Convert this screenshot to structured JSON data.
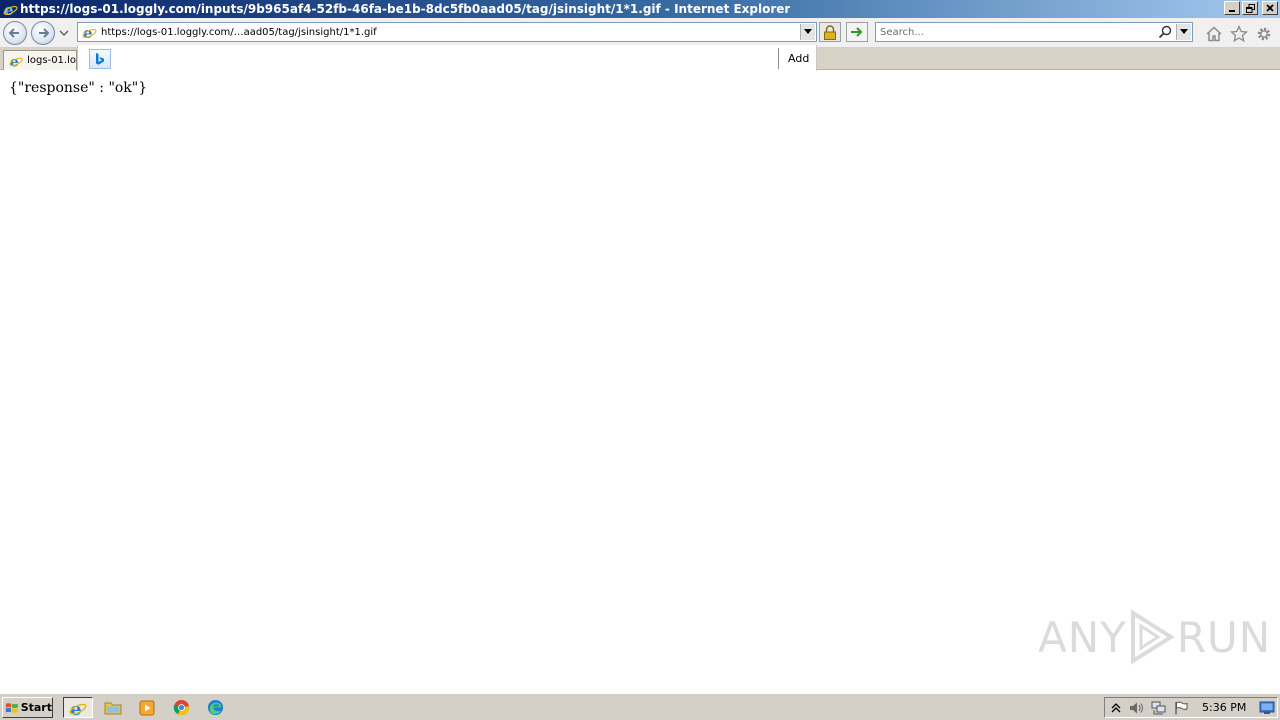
{
  "window": {
    "title": "https://logs-01.loggly.com/inputs/9b965af4-52fb-46fa-be1b-8dc5fb0aad05/tag/jsinsight/1*1.gif - Internet Explorer"
  },
  "address_bar": {
    "url_display": "https://logs-01.loggly.com/…aad05/tag/jsinsight/1*1.gif"
  },
  "search": {
    "placeholder": "Search..."
  },
  "tab": {
    "label": "logs-01.lo"
  },
  "suggestions": {
    "add_label": "Add"
  },
  "page": {
    "body_text": "{\"response\" : \"ok\"}"
  },
  "watermark": {
    "left": "ANY",
    "right": "RUN"
  },
  "taskbar": {
    "start_label": "Start",
    "clock": "5:36 PM"
  },
  "colors": {
    "title_gradient_start": "#0a246a",
    "title_gradient_end": "#a6caf0",
    "taskbar_bg": "#d4d0c8"
  }
}
